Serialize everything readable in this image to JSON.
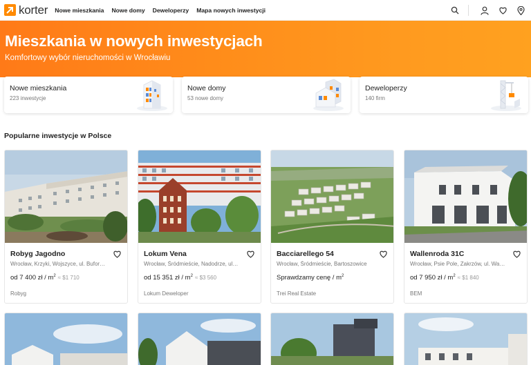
{
  "header": {
    "logo_text": "korter",
    "nav": [
      "Nowe mieszkania",
      "Nowe domy",
      "Deweloperzy",
      "Mapa nowych inwestycji"
    ],
    "icons": [
      "search-icon",
      "user-icon",
      "heart-icon",
      "location-pin-icon"
    ]
  },
  "hero": {
    "title": "Mieszkania w nowych inwestycjach",
    "subtitle": "Komfortowy wybór nieruchomości w Wrocławiu"
  },
  "categories": [
    {
      "title": "Nowe mieszkania",
      "sub": "223 inwestycje"
    },
    {
      "title": "Nowe domy",
      "sub": "53 nowe domy"
    },
    {
      "title": "Deweloperzy",
      "sub": "140 firm"
    }
  ],
  "section_title": "Popularne inwestycje w Polsce",
  "listings": [
    {
      "name": "Robyg Jagodno",
      "address": "Wrocław, Krzyki, Wojszyce, ul. Buforowa",
      "price_prefix": "od 7 400 zł / m",
      "price_sup": "2",
      "usd": "≈ $1 710",
      "developer": "Robyg"
    },
    {
      "name": "Lokum Vena",
      "address": "Wrocław, Śródmieście, Nadodrze, ul. Rydygiera",
      "price_prefix": "od 15 351 zł / m",
      "price_sup": "2",
      "usd": "≈ $3 560",
      "developer": "Lokum Deweloper"
    },
    {
      "name": "Bacciarellego 54",
      "address": "Wrocław, Śródmieście, Bartoszowice",
      "price_prefix": "Sprawdzamy cenę / m",
      "price_sup": "2",
      "usd": "",
      "developer": "Trei Real Estate"
    },
    {
      "name": "Wallenroda 31C",
      "address": "Wrocław, Psie Pole, Zakrzów, ul. Wallenroda",
      "price_prefix": "od 7 950 zł / m",
      "price_sup": "2",
      "usd": "≈ $1 840",
      "developer": "BEM"
    }
  ],
  "colors": {
    "accent": "#ff8a00",
    "hero_start": "#ff7a18",
    "hero_end": "#ffa11f"
  }
}
